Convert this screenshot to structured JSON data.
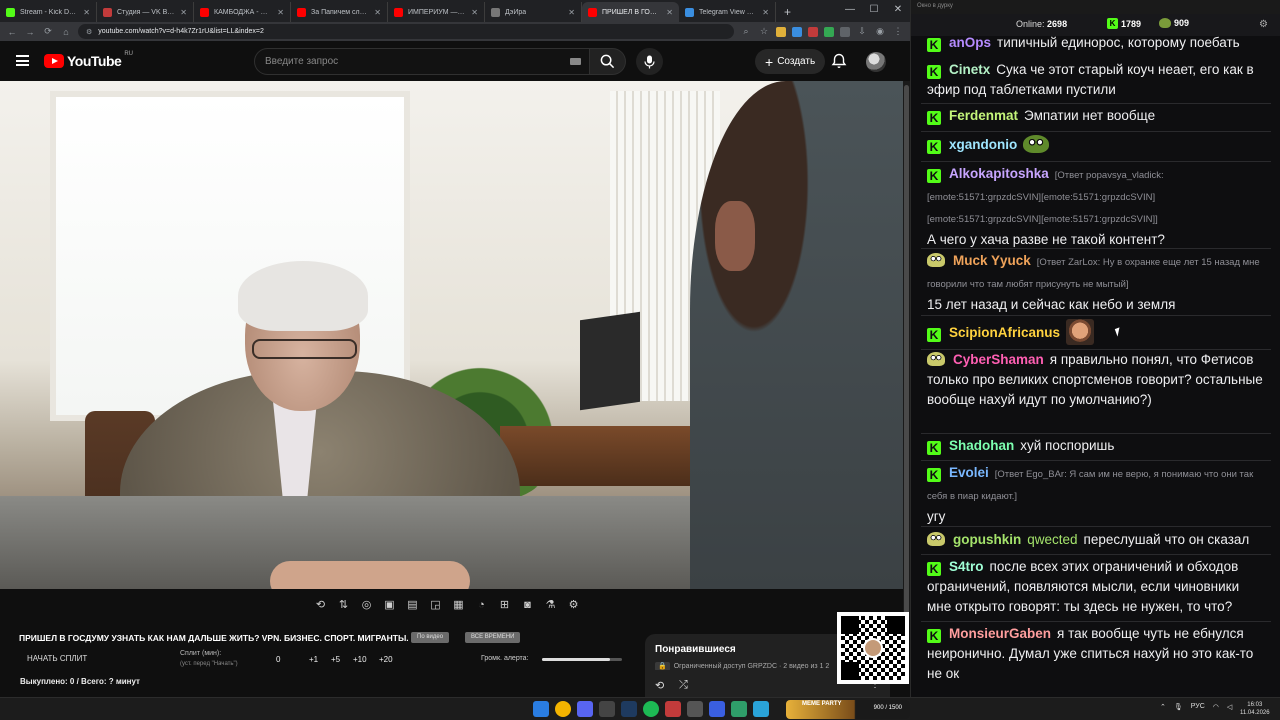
{
  "browser": {
    "tabs": [
      {
        "label": "Stream - Kick Dashboard",
        "color": "#53fc18",
        "active": false
      },
      {
        "label": "Студия — VK Видео Live",
        "color": "#c23b3b",
        "active": false
      },
      {
        "label": "КАМБОДЖА - Столица",
        "color": "#ff0000",
        "active": false
      },
      {
        "label": "За Папичем следят в р",
        "color": "#ff0000",
        "active": false
      },
      {
        "label": "ИМПЕРИУМ — НЕ РО",
        "color": "#ff0000",
        "active": false
      },
      {
        "label": "ДэЙра",
        "color": "#777777",
        "active": false
      },
      {
        "label": "ПРИШЕЛ В ГОСДУМУ",
        "color": "#ff0000",
        "active": true
      },
      {
        "label": "Telegram View @dvach",
        "color": "#3a8ee0",
        "active": false
      }
    ],
    "url": "youtube.com/watch?v=d-h4k7Zr1rU&list=LL&index=2"
  },
  "youtube": {
    "logo_text": "YouTube",
    "region": "RU",
    "search_placeholder": "Введите запрос",
    "create_label": "Создать"
  },
  "stream_panel": {
    "title": "ПРИШЕЛ В ГОСДУМУ УЗНАТЬ КАК НАМ ДАЛЬШЕ ЖИТЬ? VPN. БИЗНЕС. СПОРТ. МИГРАНТЫ.",
    "tag1": "По видео",
    "tag2": "ВСЕ ВРЕМЕНИ",
    "split_start": "НАЧАТЬ СПЛИТ",
    "split_label": "Сплит (мин):",
    "split_sub": "(уст. перед \"Начать\")",
    "split_values": [
      "0",
      "+1",
      "+5",
      "+10",
      "+20"
    ],
    "volume_label": "Громк. алерта:",
    "volume_level": 0.85,
    "bought": "Выкуплено: 0 / Всего: ? минут"
  },
  "liked": {
    "title": "Понравившиеся",
    "restricted": "Ограниченный доступ",
    "subtitle": "GRPZDC · 2 видео из 1 2"
  },
  "chat": {
    "window_title": "Окно в дурку",
    "online_label": "Online:",
    "online_count": "2698",
    "kick_count": "1789",
    "pepe_count": "909",
    "messages": [
      {
        "user": "anOps",
        "color": "#b58bff",
        "badge": "k",
        "text": "типичный единорос, которому поебать"
      },
      {
        "user": "Cinetx",
        "color": "#b4f1c6",
        "badge": "k",
        "text": "Сука че этот старый коуч неает, его как в эфир под таблетками пустили"
      },
      {
        "user": "Ferdenmat",
        "color": "#c4f57a",
        "badge": "k",
        "text": "Эмпатии нет вообще"
      },
      {
        "user": "xgandonio",
        "color": "#9fe6ff",
        "badge": "k",
        "text": ""
      },
      {
        "user": "Alkokapitoshka",
        "color": "#c7a5ff",
        "badge": "k",
        "reply": "[Ответ popavsya_vladick: [emote:51571:grpzdcSVIN][emote:51571:grpzdcSVIN] [emote:51571:grpzdcSVIN][emote:51571:grpzdcSVIN]]",
        "text": "А чего у хача разве не такой контент?"
      },
      {
        "user": "Muck Yyuck",
        "color": "#f0a35a",
        "badge": "p",
        "reply": "[Ответ ZarLox: Ну в охранке еще лет 15 назад мне говорили что там любят присунуть не мытый]",
        "text": "15 лет назад и сейчас как небо и земля"
      },
      {
        "user": "ScipionAfricanus",
        "color": "#ffd23f",
        "badge": "k",
        "text": ""
      },
      {
        "user": "CyberShaman",
        "color": "#ff5fb3",
        "badge": "p",
        "text": "я правильно понял, что Фетисов только про великих спортсменов говорит? остальные вообще нахуй идут по умолчанию?)"
      },
      {
        "user": "Shadohan",
        "color": "#7dffb0",
        "badge": "k",
        "text": "хуй поспоришь"
      },
      {
        "user": "Evolei",
        "color": "#7ab8ff",
        "badge": "k",
        "reply": "[Ответ Ego_BAr: Я сам им не верю, я понимаю что они так себя в пиар кидают.]",
        "text": "угу"
      },
      {
        "user": "gopushkin",
        "color": "#a4e36b",
        "badge": "p",
        "mention": "qwected",
        "text": "переслушай что он сказал"
      },
      {
        "user": "S4tro",
        "color": "#a0ffd6",
        "badge": "k",
        "text": "после всех этих ограничений и обходов ограничений, появляются мысли, если чиновники мне открыто говорят: ты здесь не нужен, то что?"
      },
      {
        "user": "MonsieurGaben",
        "color": "#ff9e9e",
        "badge": "k",
        "text": "я так вообще чуть не ебнулся неиронично. Думал уже спиться нахуй но это как-то не ок"
      }
    ]
  },
  "taskbar": {
    "meme_party_label": "MEME PARTY",
    "meme_party_count": "900 / 1500",
    "lang": "РУС",
    "time": "16:03",
    "date": "11.04.2026"
  }
}
